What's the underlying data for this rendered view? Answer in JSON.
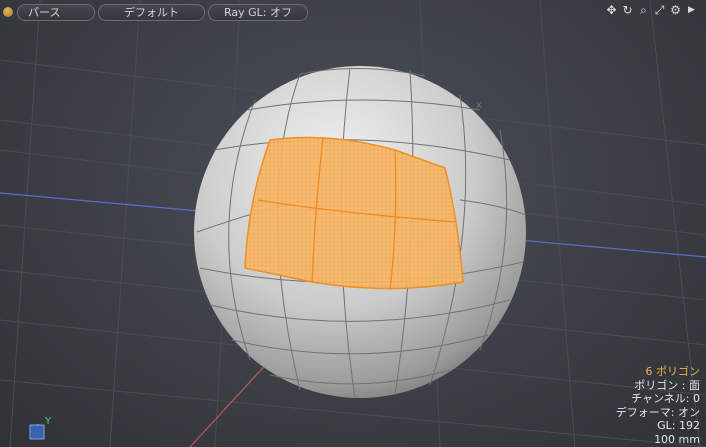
{
  "toolbar": {
    "buttons": [
      "パース",
      "デフォルト",
      "Ray GL: オフ"
    ]
  },
  "nav_icons": [
    "move-icon",
    "rotate-icon",
    "zoom-icon",
    "fit-icon",
    "settings-icon",
    "more-arrow-icon"
  ],
  "info": {
    "selection": "6 ポリゴン",
    "polygon_type": "ポリゴン : 面",
    "channel": "チャンネル: 0",
    "deformer": "デフォーマ: オン",
    "gl": "GL: 192",
    "grid_size": "100 mm"
  },
  "axis_label": "Y",
  "colors": {
    "background": "#3c4046",
    "grid": "#4a4e54",
    "x_axis": "#5a6ccc",
    "z_axis": "#b85a58",
    "sphere": "#c8c8c8",
    "selection_fill": "#f4b266",
    "selection_edge": "#f08c1c",
    "info_highlight": "#f2b24b"
  }
}
